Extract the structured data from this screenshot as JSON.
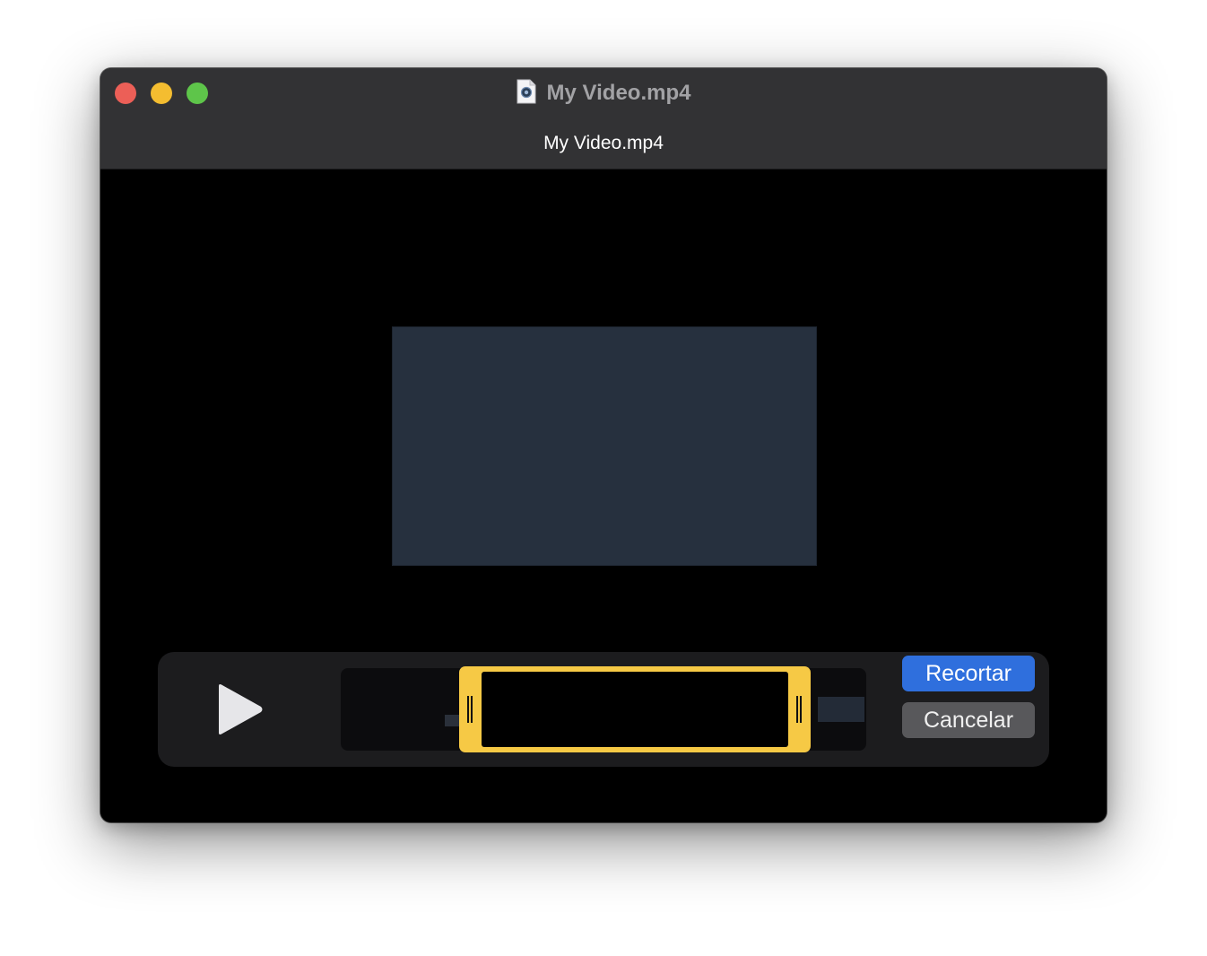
{
  "window": {
    "title": "My Video.mp4",
    "subtitle": "My Video.mp4",
    "traffic_lights": {
      "close_color": "#ec5f57",
      "minimize_color": "#f4bd30",
      "zoom_color": "#5ec54a"
    },
    "title_icon": "video-document-icon"
  },
  "player": {
    "play_icon": "play-icon",
    "trim_selection_color": "#f6c945"
  },
  "actions": {
    "trim_label": "Recortar",
    "cancel_label": "Cancelar",
    "accent_color": "#2f6fdd"
  }
}
